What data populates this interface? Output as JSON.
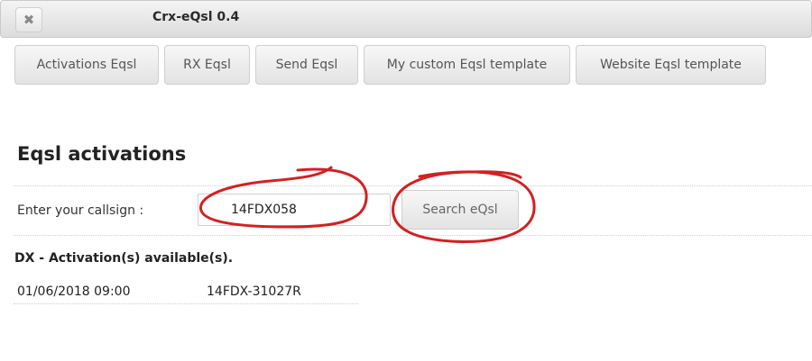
{
  "window": {
    "title": "Crx-eQsl 0.4",
    "close_icon": "close-icon",
    "close_glyph": "✖"
  },
  "tabs": [
    {
      "label": "Activations Eqsl"
    },
    {
      "label": "RX Eqsl"
    },
    {
      "label": "Send Eqsl"
    },
    {
      "label": "My custom Eqsl template"
    },
    {
      "label": "Website Eqsl template"
    }
  ],
  "main": {
    "heading": "Eqsl activations",
    "callsign_label": "Enter your callsign :",
    "callsign_value": "14FDX058",
    "search_button": "Search eQsl",
    "results_title": "DX - Activation(s) available(s).",
    "results": [
      {
        "datetime": "01/06/2018 09:00",
        "reference": "14FDX-31027R"
      }
    ]
  },
  "annotation_color": "#d42020"
}
